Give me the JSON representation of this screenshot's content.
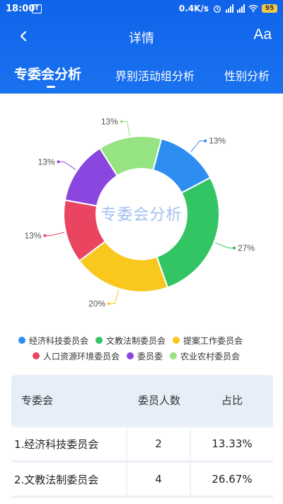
{
  "status": {
    "time": "18:00",
    "net_speed": "0.4K/s",
    "battery": "95"
  },
  "nav": {
    "title": "详情",
    "font_button": "Aa"
  },
  "tabs": [
    {
      "label": "专委会分析"
    },
    {
      "label": "界别活动组分析"
    },
    {
      "label": "性别分析"
    }
  ],
  "chart_data": {
    "type": "pie",
    "title": "专委会分析",
    "categories": [
      "经济科技委员会",
      "文教法制委员会",
      "提案工作委员会",
      "人口资源环境委员会",
      "委员委",
      "农业农村委员会"
    ],
    "values": [
      13,
      27,
      20,
      13,
      13,
      13
    ],
    "labels": [
      "13%",
      "27%",
      "20%",
      "13%",
      "13%",
      "13%"
    ],
    "colors": [
      "#2e8ef0",
      "#33c463",
      "#f8c81e",
      "#e94561",
      "#8a46df",
      "#96e481"
    ],
    "legend_position": "bottom"
  },
  "table": {
    "headers": [
      "专委会",
      "委员人数",
      "占比"
    ],
    "rows": [
      [
        "1.经济科技委员会",
        "2",
        "13.33%"
      ],
      [
        "2.文教法制委员会",
        "4",
        "26.67%"
      ]
    ]
  }
}
